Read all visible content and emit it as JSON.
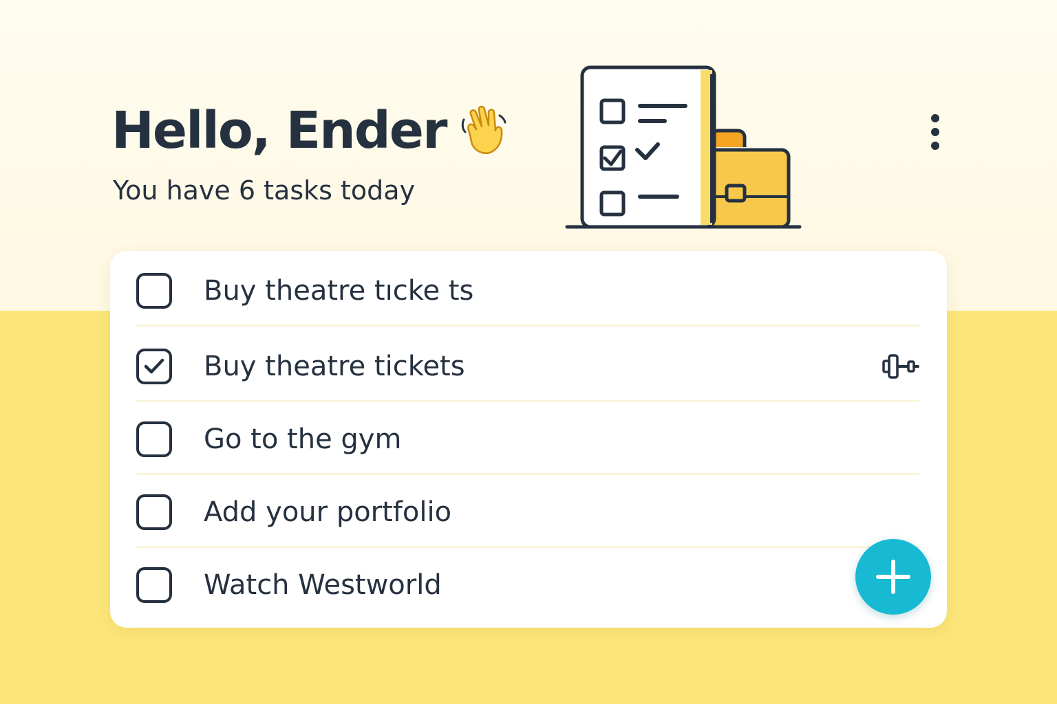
{
  "header": {
    "title": "Hello, Ender",
    "subtitle": "You have 6 tasks today",
    "wave_icon": "waving-hand-icon",
    "illustration_icon": "checklist-briefcase-illustration",
    "menu_icon": "more-vertical-icon"
  },
  "tasks": [
    {
      "label": "Buy theatre tıcke ts",
      "checked": false
    },
    {
      "label": "Buy theatre tickets",
      "checked": true,
      "icon": "dumbbell-icon"
    },
    {
      "label": "Go to the gym",
      "checked": false
    },
    {
      "label": "Add your portfolio",
      "checked": false
    },
    {
      "label": "Watch Westworld",
      "checked": false
    }
  ],
  "fab": {
    "icon": "plus-icon"
  },
  "colors": {
    "background_top": "#fff9e6",
    "background_bottom": "#fde679",
    "text": "#263140",
    "accent": "#18b9d3",
    "briefcase": "#f8c84a"
  }
}
